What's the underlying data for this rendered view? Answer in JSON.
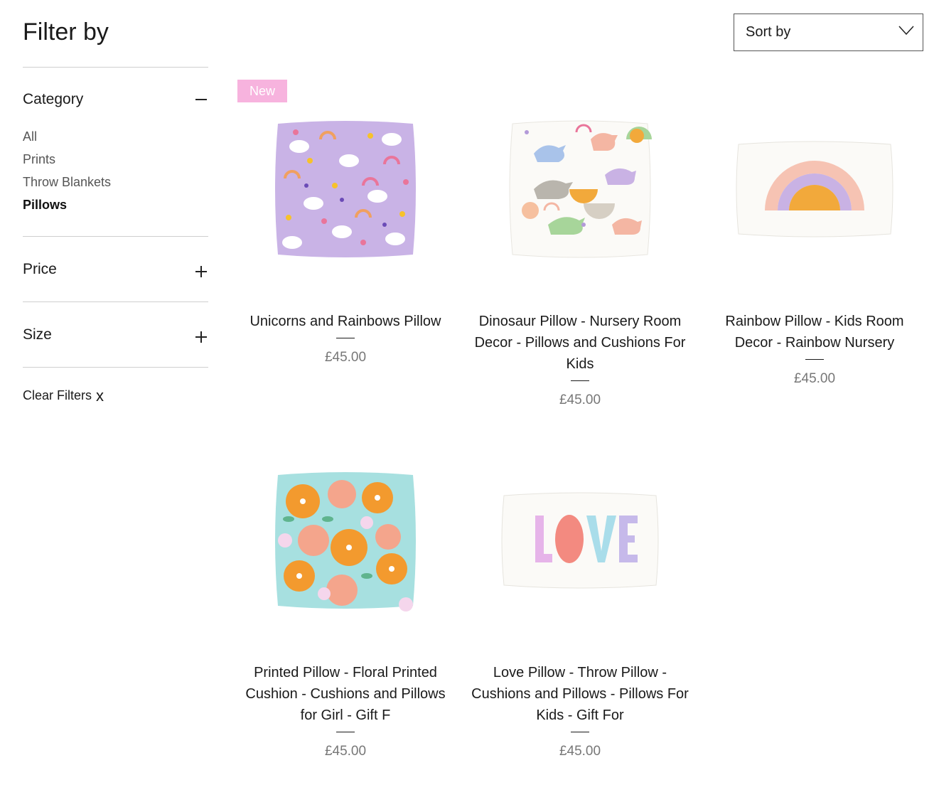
{
  "filter": {
    "title": "Filter by",
    "category": {
      "label": "Category",
      "items": [
        "All",
        "Prints",
        "Throw Blankets",
        "Pillows"
      ],
      "active": "Pillows"
    },
    "price": {
      "label": "Price"
    },
    "size": {
      "label": "Size"
    },
    "clear": {
      "label": "Clear Filters",
      "icon": "x"
    }
  },
  "sort": {
    "label": "Sort by"
  },
  "badge": {
    "label": "New"
  },
  "products": [
    {
      "name": "Unicorns and Rainbows Pillow",
      "price": "£45.00"
    },
    {
      "name": "Dinosaur Pillow - Nursery Room Decor - Pillows and Cushions For Kids",
      "price": "£45.00"
    },
    {
      "name": "Rainbow Pillow - Kids Room Decor - Rainbow Nursery",
      "price": "£45.00"
    },
    {
      "name": "Printed Pillow - Floral Printed Cushion - Cushions and Pillows for Girl - Gift F",
      "price": "£45.00"
    },
    {
      "name": "Love Pillow - Throw Pillow - Cushions and Pillows - Pillows For Kids - Gift For",
      "price": "£45.00"
    }
  ],
  "love_pillow_text": "LOVE",
  "colors": {
    "badge": "#f7b3de",
    "price": "#777777",
    "divider": "#cfcfcf"
  }
}
